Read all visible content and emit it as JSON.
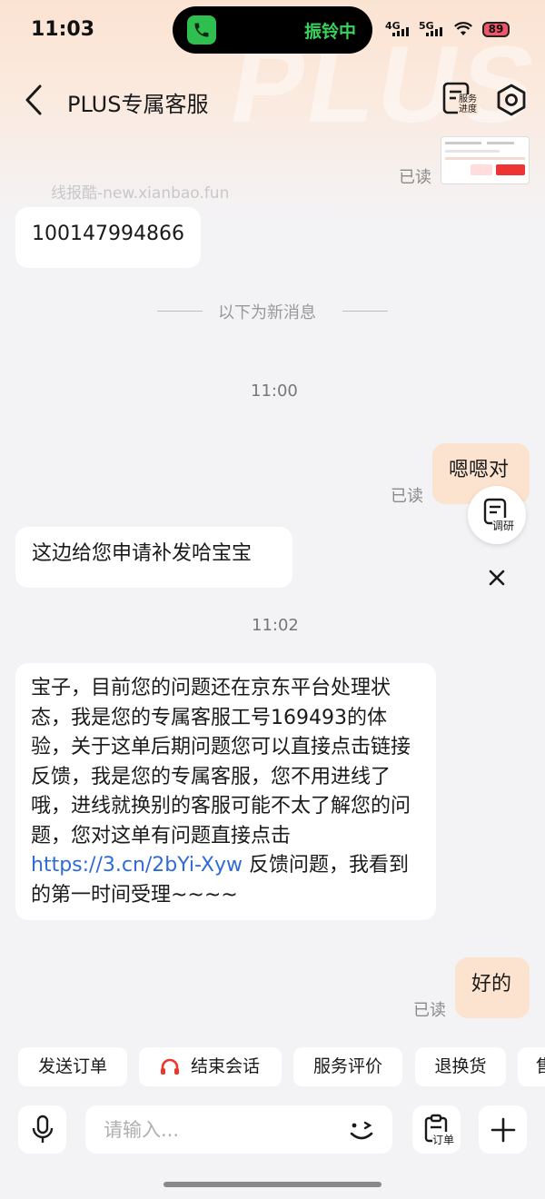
{
  "status_bar": {
    "time": "11:03",
    "call_status": "振铃中",
    "net1": "4G",
    "net2": "5G",
    "battery": "89"
  },
  "header": {
    "title": "PLUS专属客服",
    "service_progress_label": "服务\n进度",
    "back_icon": "chevron-left-icon",
    "settings_icon": "hexagon-gear-icon"
  },
  "watermarks": {
    "site": "线报酷-new.xianbao.fun",
    "brand": "PLUS"
  },
  "chat": {
    "read_label": "已读",
    "new_messages_divider": "以下为新消息",
    "messages": [
      {
        "side": "right",
        "type": "image",
        "read": "已读"
      },
      {
        "side": "left",
        "text": "100147994866"
      },
      {
        "side": "right",
        "text": "嗯嗯对",
        "read": "已读"
      },
      {
        "side": "left",
        "text": "这边给您申请补发哈宝宝"
      },
      {
        "side": "left",
        "text_before_link": "宝子，目前您的问题还在京东平台处理状态，我是您的专属客服工号169493的体验，关于这单后期问题您可以直接点击链接反馈，我是您的专属客服，您不用进线了哦，进线就换别的客服可能不太了解您的问题，您对这单有问题直接点击 ",
        "link": "https://3.cn/2bYi-Xyw",
        "text_after_link": " 反馈问题，我看到的第一时间受理~~~~"
      },
      {
        "side": "right",
        "text": "好的",
        "read": "已读"
      }
    ],
    "timestamps": [
      "11:00",
      "11:02"
    ],
    "survey_label": "调研"
  },
  "quick_actions": [
    "发送订单",
    "结束会话",
    "服务评价",
    "退换货",
    "售"
  ],
  "input_bar": {
    "placeholder": "请输入...",
    "order_label": "订单"
  },
  "colors": {
    "accent_peach": "#fbe3cf",
    "link_blue": "#2f6bd8",
    "call_green": "#38d35a"
  }
}
